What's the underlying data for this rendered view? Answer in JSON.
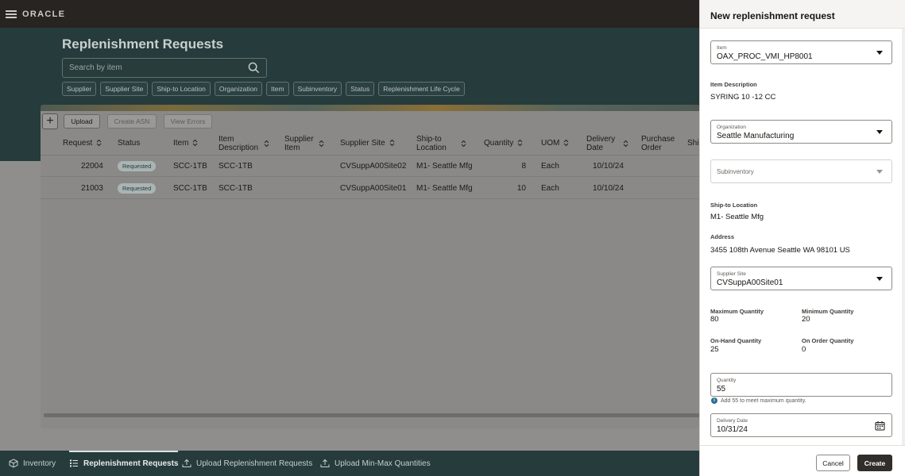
{
  "app": {
    "logo": "ORACLE"
  },
  "page": {
    "title": "Replenishment Requests"
  },
  "search": {
    "placeholder": "Search by item"
  },
  "filters": [
    "Supplier",
    "Supplier Site",
    "Ship-to Location",
    "Organization",
    "Item",
    "Subinventory",
    "Status",
    "Replenishment Life Cycle"
  ],
  "toolbar": {
    "add": "+",
    "upload": "Upload",
    "create_asn": "Create ASN",
    "view_errors": "View Errors"
  },
  "table": {
    "headers": {
      "request": "Request",
      "status": "Status",
      "item": "Item",
      "item_description_1": "Item",
      "item_description_2": "Description",
      "supplier_item_1": "Supplier",
      "supplier_item_2": "Item",
      "supplier_site": "Supplier Site",
      "ship_to_1": "Ship-to",
      "ship_to_2": "Location",
      "quantity": "Quantity",
      "uom": "UOM",
      "delivery_date_1": "Delivery",
      "delivery_date_2": "Date",
      "purchase_order_1": "Purchase",
      "purchase_order_2": "Order",
      "cut": "Shi"
    },
    "rows": [
      {
        "request": "22004",
        "status": "Requested",
        "item": "SCC-1TB",
        "description": "SCC-1TB",
        "supplier_item": "",
        "supplier_site": "CVSuppA00Site02",
        "ship_to": "M1- Seattle Mfg",
        "quantity": "8",
        "uom": "Each",
        "delivery_date": "10/10/24",
        "purchase_order": ""
      },
      {
        "request": "21003",
        "status": "Requested",
        "item": "SCC-1TB",
        "description": "SCC-1TB",
        "supplier_item": "",
        "supplier_site": "CVSuppA00Site01",
        "ship_to": "M1- Seattle Mfg",
        "quantity": "10",
        "uom": "Each",
        "delivery_date": "10/10/24",
        "purchase_order": ""
      }
    ]
  },
  "bottom_nav": {
    "inventory": "Inventory",
    "replenishment_requests": "Replenishment Requests",
    "upload_requests": "Upload Replenishment Requests",
    "upload_minmax": "Upload Min-Max Quantities"
  },
  "drawer": {
    "title": "New replenishment request",
    "item": {
      "label": "Item",
      "value": "OAX_PROC_VMI_HP8001"
    },
    "item_description": {
      "label": "Item Description",
      "value": "SYRING 10 -12 CC"
    },
    "organization": {
      "label": "Organization",
      "value": "Seattle Manufacturing"
    },
    "subinventory": {
      "placeholder": "Subinventory"
    },
    "ship_to": {
      "label": "Ship-to Location",
      "value": "M1- Seattle Mfg"
    },
    "address": {
      "label": "Address",
      "value": "3455 108th Avenue Seattle WA 98101 US"
    },
    "supplier_site": {
      "label": "Supplier Site",
      "value": "CVSuppA00Site01"
    },
    "max_qty": {
      "label": "Maximum Quantity",
      "value": "80"
    },
    "min_qty": {
      "label": "Minimum Quantity",
      "value": "20"
    },
    "onhand_qty": {
      "label": "On-Hand Quantity",
      "value": "25"
    },
    "onorder_qty": {
      "label": "On Order Quantity",
      "value": "0"
    },
    "quantity": {
      "label": "Quantity",
      "value": "55",
      "hint": "Add 55 to meet maximum quantity."
    },
    "delivery_date": {
      "label": "Delivery Date",
      "value": "10/31/24"
    },
    "cancel": "Cancel",
    "create": "Create"
  }
}
